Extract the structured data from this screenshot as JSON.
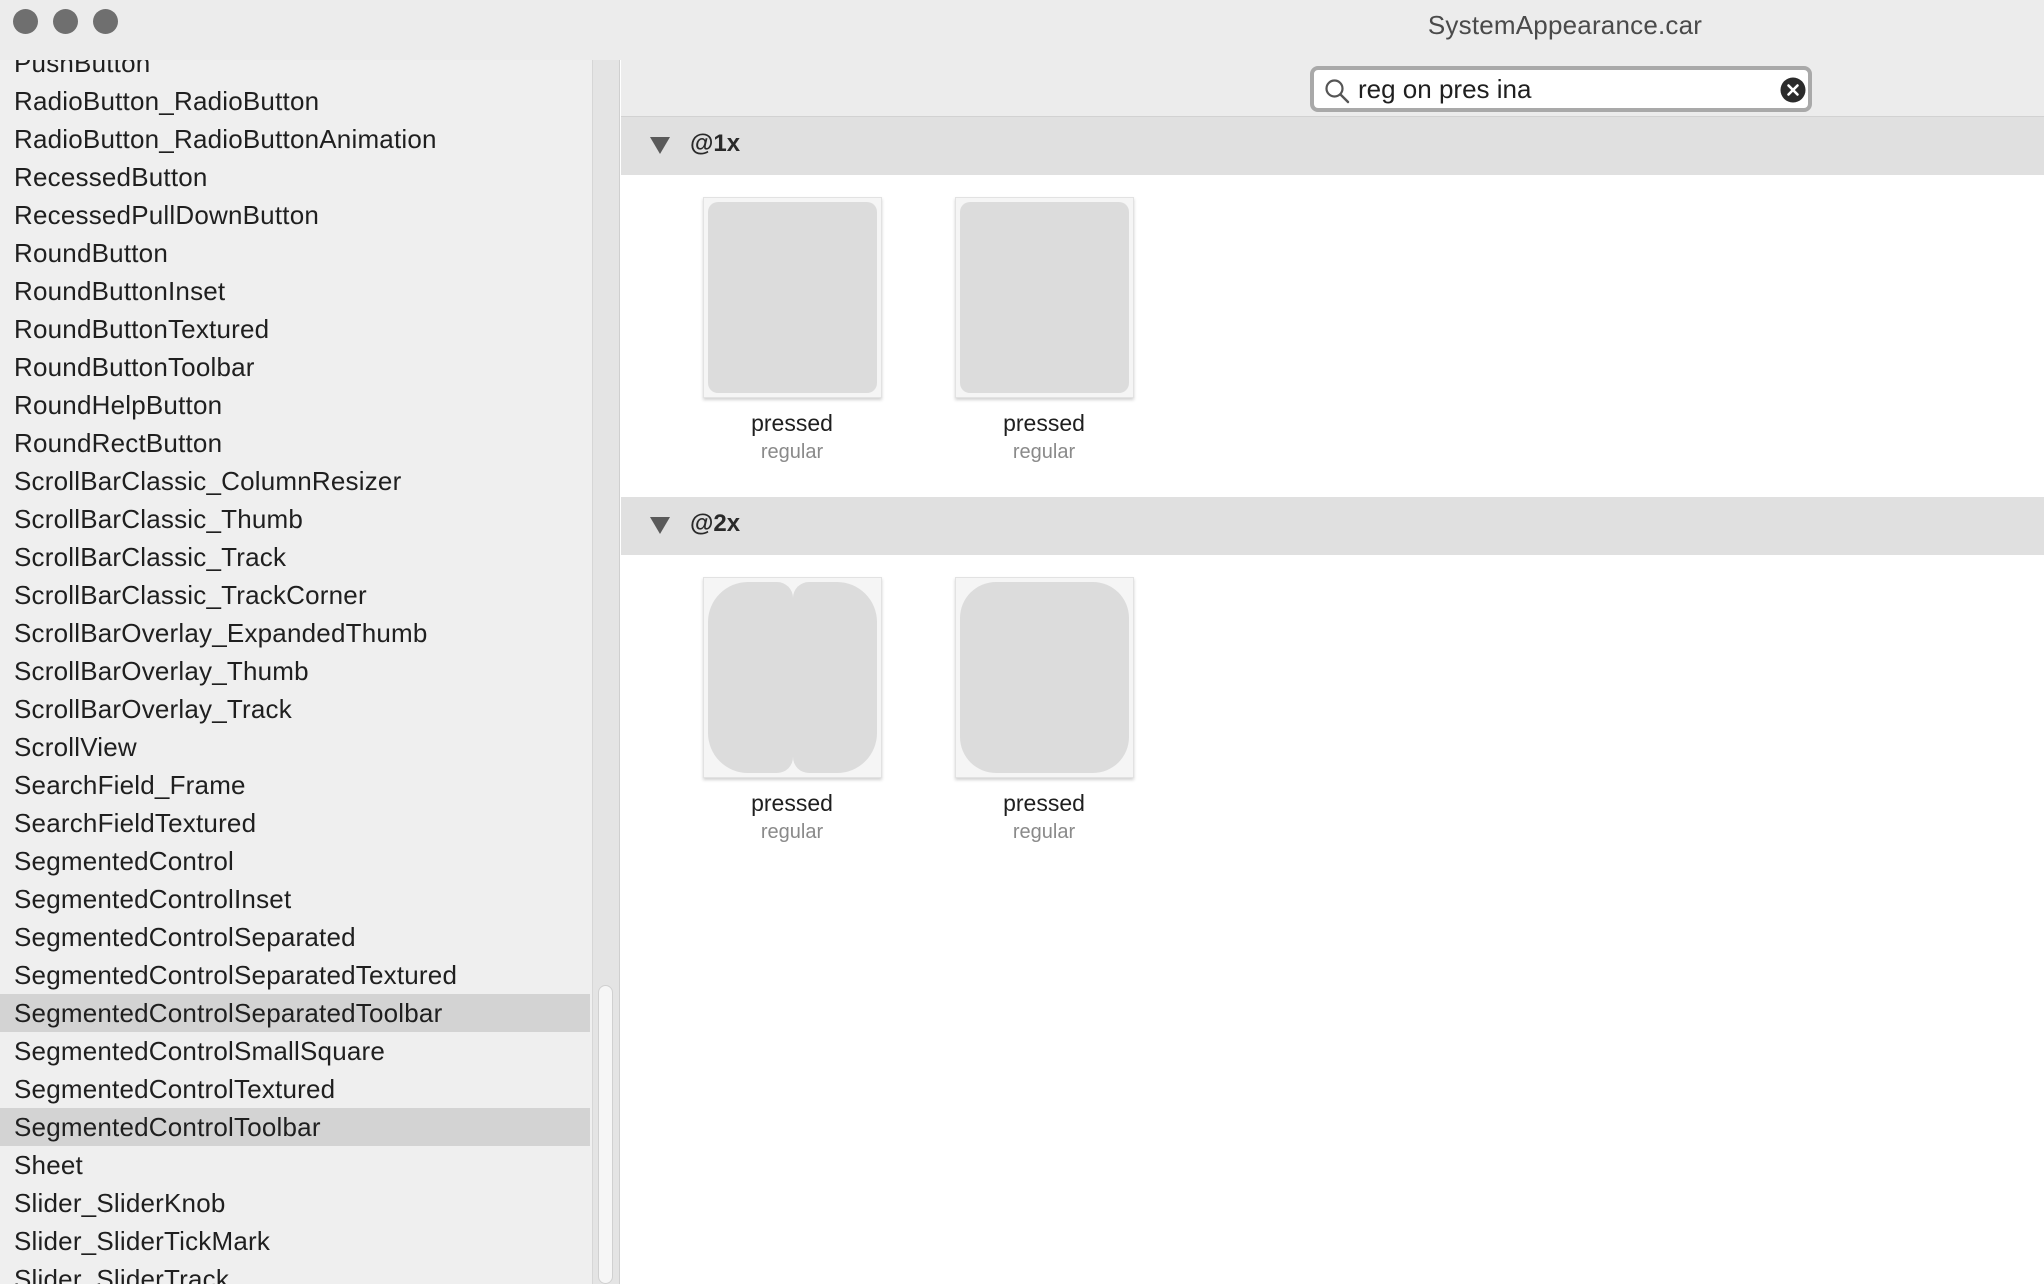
{
  "window": {
    "title": "SystemAppearance.car"
  },
  "sidebar": {
    "items": [
      {
        "label": "PushButton",
        "selected": false
      },
      {
        "label": "RadioButton_RadioButton",
        "selected": false
      },
      {
        "label": "RadioButton_RadioButtonAnimation",
        "selected": false
      },
      {
        "label": "RecessedButton",
        "selected": false
      },
      {
        "label": "RecessedPullDownButton",
        "selected": false
      },
      {
        "label": "RoundButton",
        "selected": false
      },
      {
        "label": "RoundButtonInset",
        "selected": false
      },
      {
        "label": "RoundButtonTextured",
        "selected": false
      },
      {
        "label": "RoundButtonToolbar",
        "selected": false
      },
      {
        "label": "RoundHelpButton",
        "selected": false
      },
      {
        "label": "RoundRectButton",
        "selected": false
      },
      {
        "label": "ScrollBarClassic_ColumnResizer",
        "selected": false
      },
      {
        "label": "ScrollBarClassic_Thumb",
        "selected": false
      },
      {
        "label": "ScrollBarClassic_Track",
        "selected": false
      },
      {
        "label": "ScrollBarClassic_TrackCorner",
        "selected": false
      },
      {
        "label": "ScrollBarOverlay_ExpandedThumb",
        "selected": false
      },
      {
        "label": "ScrollBarOverlay_Thumb",
        "selected": false
      },
      {
        "label": "ScrollBarOverlay_Track",
        "selected": false
      },
      {
        "label": "ScrollView",
        "selected": false
      },
      {
        "label": "SearchField_Frame",
        "selected": false
      },
      {
        "label": "SearchFieldTextured",
        "selected": false
      },
      {
        "label": "SegmentedControl",
        "selected": false
      },
      {
        "label": "SegmentedControlInset",
        "selected": false
      },
      {
        "label": "SegmentedControlSeparated",
        "selected": false
      },
      {
        "label": "SegmentedControlSeparatedTextured",
        "selected": false
      },
      {
        "label": "SegmentedControlSeparatedToolbar",
        "selected": true
      },
      {
        "label": "SegmentedControlSmallSquare",
        "selected": false
      },
      {
        "label": "SegmentedControlTextured",
        "selected": false
      },
      {
        "label": "SegmentedControlToolbar",
        "selected": true
      },
      {
        "label": "Sheet",
        "selected": false
      },
      {
        "label": "Slider_SliderKnob",
        "selected": false
      },
      {
        "label": "Slider_SliderTickMark",
        "selected": false
      },
      {
        "label": "Slider_SliderTrack",
        "selected": false
      }
    ]
  },
  "search": {
    "value": "reg on pres ina",
    "icon": "magnifying-glass-icon",
    "clear_icon": "clear-circle-x-icon"
  },
  "sections": [
    {
      "title": "@1x",
      "expanded": true,
      "assets": [
        {
          "name": "pressed",
          "size_class": "regular"
        },
        {
          "name": "pressed",
          "size_class": "regular"
        }
      ]
    },
    {
      "title": "@2x",
      "expanded": true,
      "assets": [
        {
          "name": "pressed",
          "size_class": "regular"
        },
        {
          "name": "pressed",
          "size_class": "regular"
        }
      ]
    }
  ],
  "colors": {
    "selection": "#d3d3d3",
    "section_header": "#e0e0e0",
    "sidebar_bg": "#efefef"
  }
}
